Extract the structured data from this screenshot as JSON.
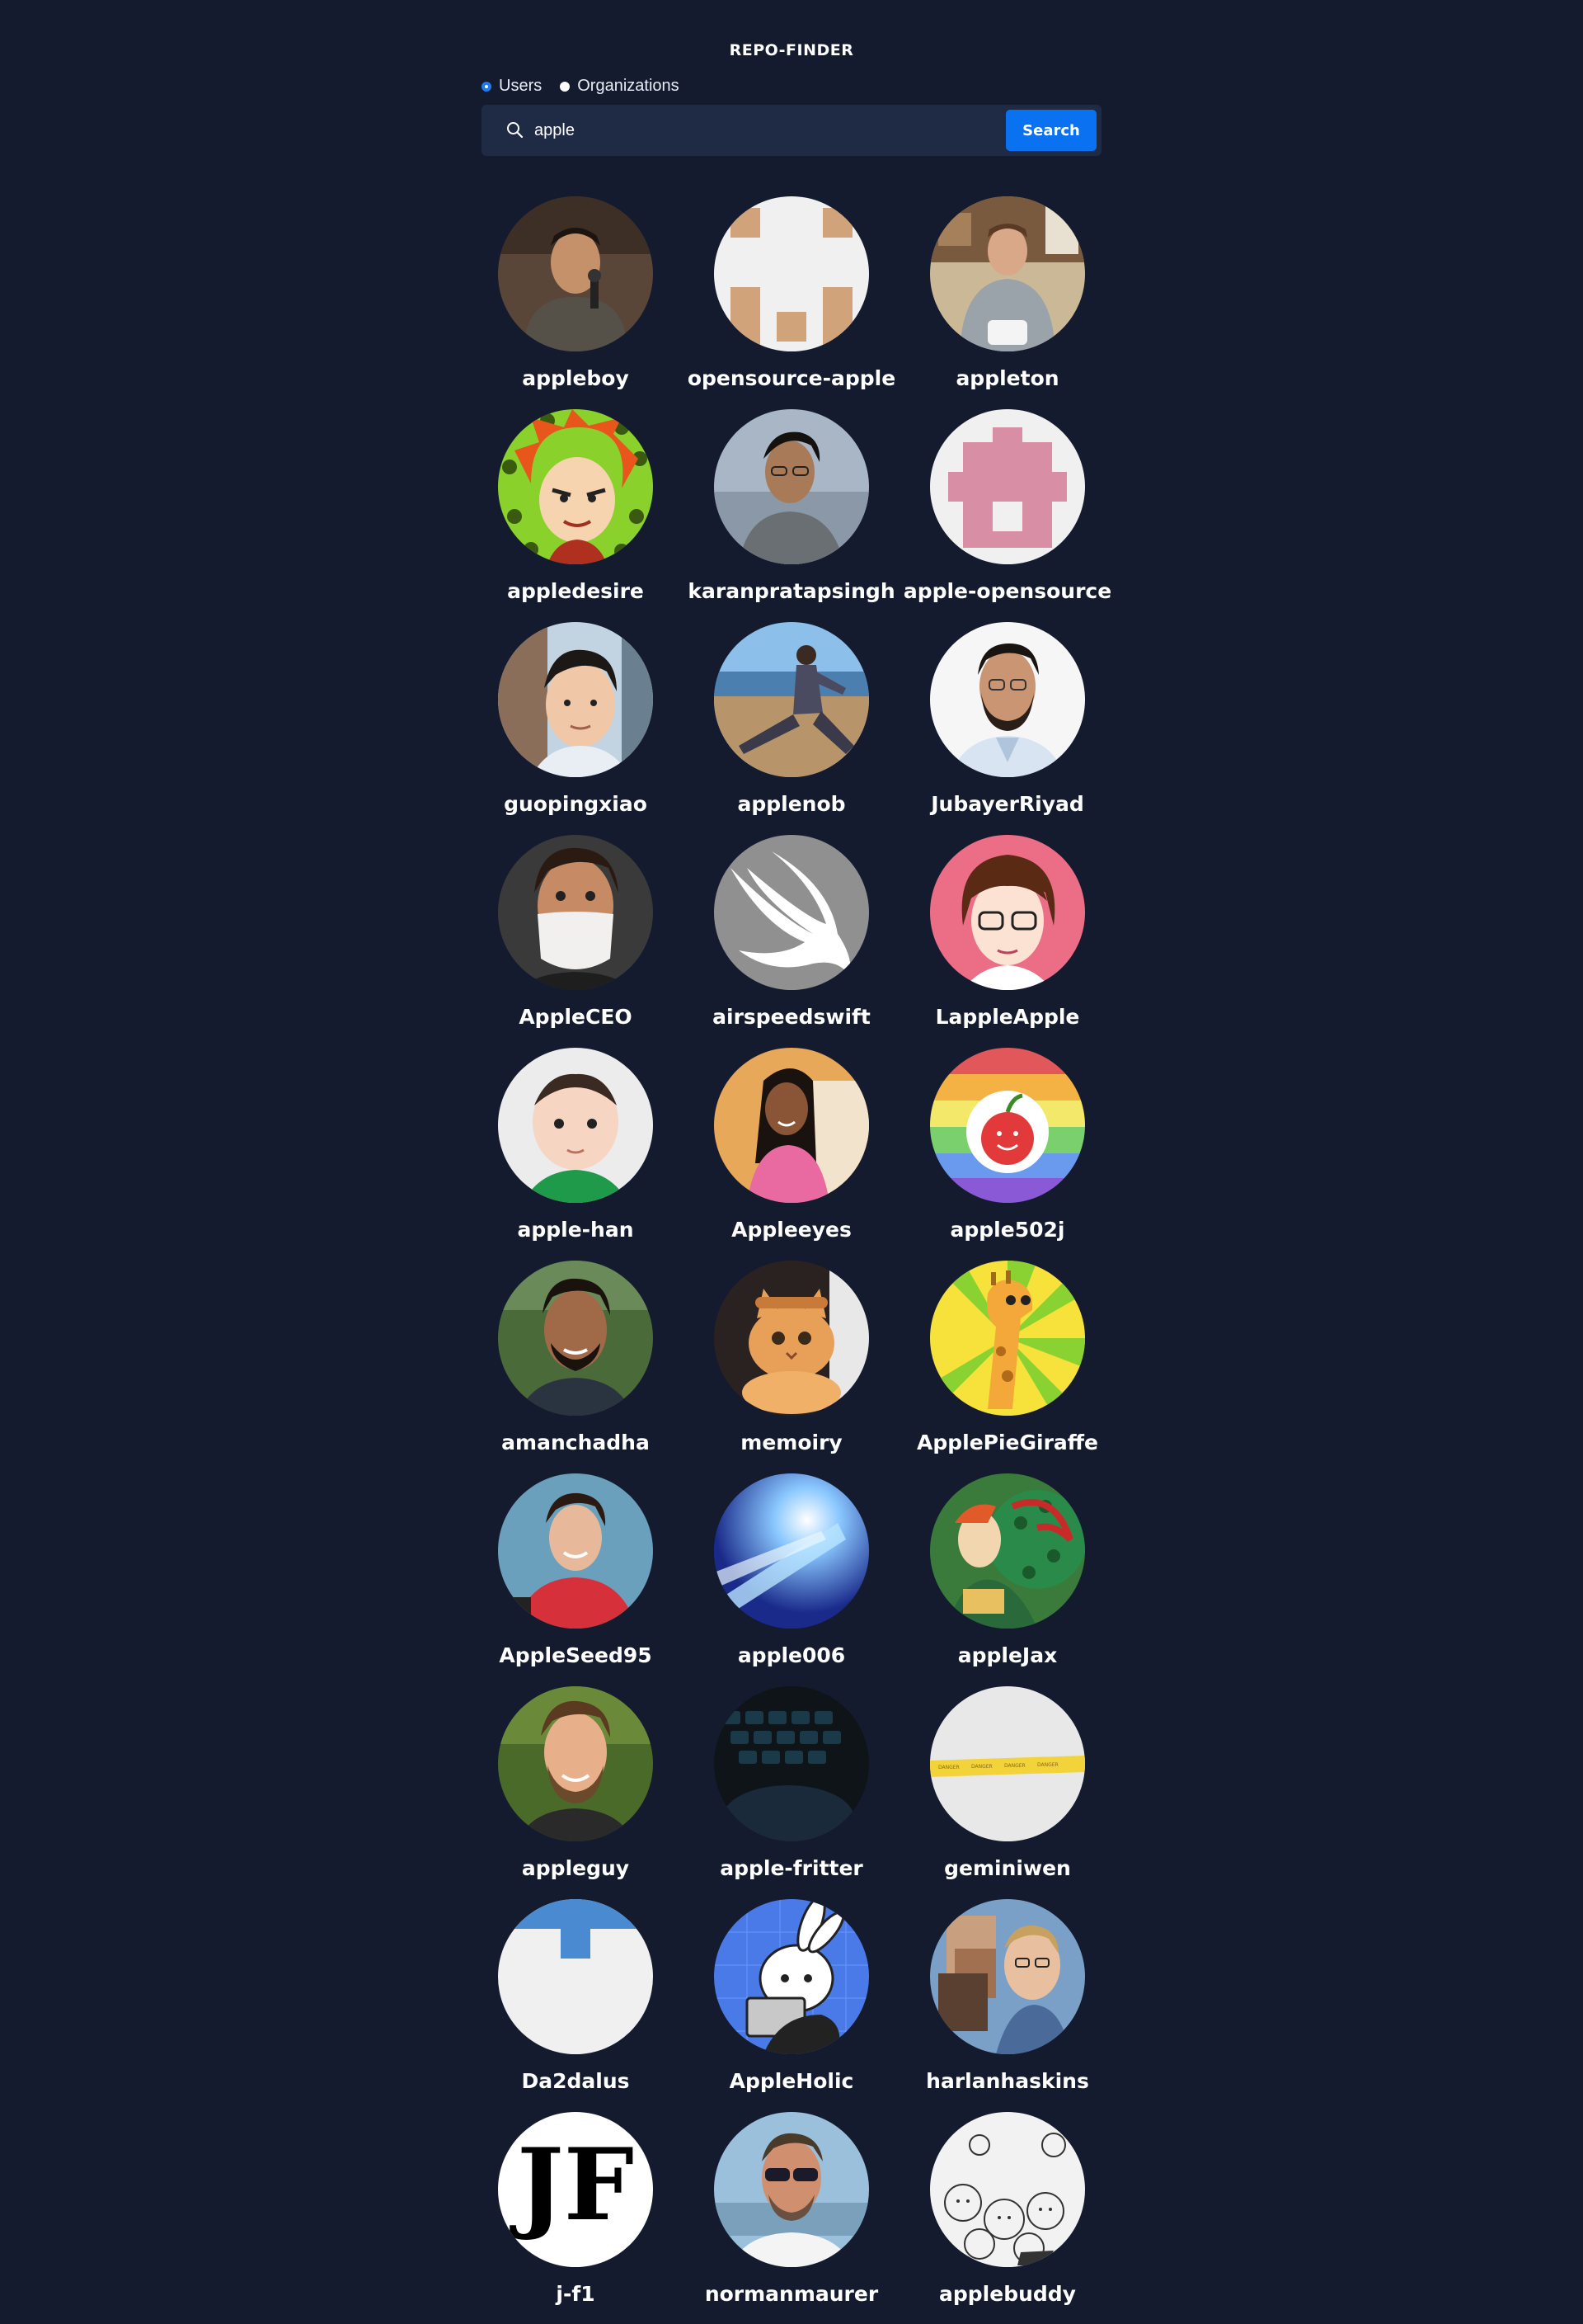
{
  "header": {
    "title": "REPO-FINDER"
  },
  "search_type": {
    "options": [
      "Users",
      "Organizations"
    ],
    "selected": "Users"
  },
  "search": {
    "value": "apple",
    "button_label": "Search"
  },
  "results": [
    {
      "login": "appleboy",
      "avatar": "photo-man-microphone"
    },
    {
      "login": "opensource-apple",
      "avatar": "identicon-tan"
    },
    {
      "login": "appleton",
      "avatar": "photo-man-cafe"
    },
    {
      "login": "appledesire",
      "avatar": "cartoon-red-hair"
    },
    {
      "login": "karanpratapsingh",
      "avatar": "photo-man-glasses"
    },
    {
      "login": "apple-opensource",
      "avatar": "identicon-pink"
    },
    {
      "login": "guopingxiao",
      "avatar": "photo-young-man"
    },
    {
      "login": "applenob",
      "avatar": "photo-beach-sitting"
    },
    {
      "login": "JubayerRiyad",
      "avatar": "photo-man-beard"
    },
    {
      "login": "AppleCEO",
      "avatar": "photo-man-mask"
    },
    {
      "login": "airspeedswift",
      "avatar": "swift-logo"
    },
    {
      "login": "LappleApple",
      "avatar": "cartoon-glasses-pink"
    },
    {
      "login": "apple-han",
      "avatar": "photo-baby"
    },
    {
      "login": "Appleeyes",
      "avatar": "photo-woman-smiling"
    },
    {
      "login": "apple502j",
      "avatar": "rainbow-apple-face"
    },
    {
      "login": "amanchadha",
      "avatar": "photo-man-smiling-trees"
    },
    {
      "login": "memoiry",
      "avatar": "photo-orange-cat"
    },
    {
      "login": "ApplePieGiraffe",
      "avatar": "giraffe-sunburst"
    },
    {
      "login": "AppleSeed95",
      "avatar": "photo-man-red-shirt"
    },
    {
      "login": "apple006",
      "avatar": "blue-light-burst"
    },
    {
      "login": "appleJax",
      "avatar": "green-illustration"
    },
    {
      "login": "appleguy",
      "avatar": "photo-man-bearded-green"
    },
    {
      "login": "apple-fritter",
      "avatar": "dark-keyboard"
    },
    {
      "login": "geminiwen",
      "avatar": "tape-on-white"
    },
    {
      "login": "Da2dalus",
      "avatar": "identicon-blue"
    },
    {
      "login": "AppleHolic",
      "avatar": "bunny-laptop"
    },
    {
      "login": "harlanhaskins",
      "avatar": "photo-faces-collage"
    },
    {
      "login": "j-f1",
      "avatar": "jf-monogram"
    },
    {
      "login": "normanmaurer",
      "avatar": "photo-man-sunglasses"
    },
    {
      "login": "applebuddy",
      "avatar": "sketch-doodles"
    }
  ]
}
